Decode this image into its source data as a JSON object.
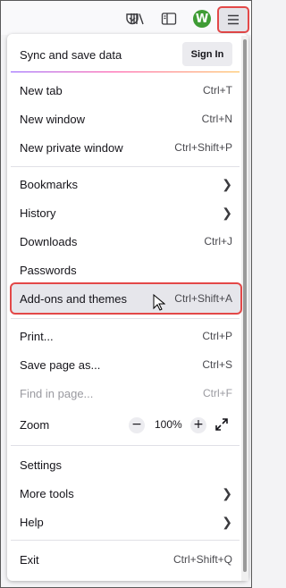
{
  "toolbar": {
    "icons": [
      "pocket-icon",
      "library-icon",
      "sidebar-icon",
      "extension-icon",
      "hamburger-menu-icon"
    ],
    "extension_letter": "W",
    "extension_color": "#3f9c35",
    "highlight_color": "#e34848"
  },
  "sync": {
    "label": "Sync and save data",
    "button": "Sign In"
  },
  "menu": {
    "new_tab": {
      "label": "New tab",
      "shortcut": "Ctrl+T"
    },
    "new_window": {
      "label": "New window",
      "shortcut": "Ctrl+N"
    },
    "new_private": {
      "label": "New private window",
      "shortcut": "Ctrl+Shift+P"
    },
    "bookmarks": {
      "label": "Bookmarks"
    },
    "history": {
      "label": "History"
    },
    "downloads": {
      "label": "Downloads",
      "shortcut": "Ctrl+J"
    },
    "passwords": {
      "label": "Passwords"
    },
    "addons": {
      "label": "Add-ons and themes",
      "shortcut": "Ctrl+Shift+A"
    },
    "print": {
      "label": "Print...",
      "shortcut": "Ctrl+P"
    },
    "save_page": {
      "label": "Save page as...",
      "shortcut": "Ctrl+S"
    },
    "find": {
      "label": "Find in page...",
      "shortcut": "Ctrl+F"
    },
    "zoom": {
      "label": "Zoom",
      "minus": "−",
      "value": "100%",
      "plus": "+"
    },
    "settings": {
      "label": "Settings"
    },
    "more_tools": {
      "label": "More tools"
    },
    "help": {
      "label": "Help"
    },
    "exit": {
      "label": "Exit",
      "shortcut": "Ctrl+Shift+Q"
    }
  }
}
